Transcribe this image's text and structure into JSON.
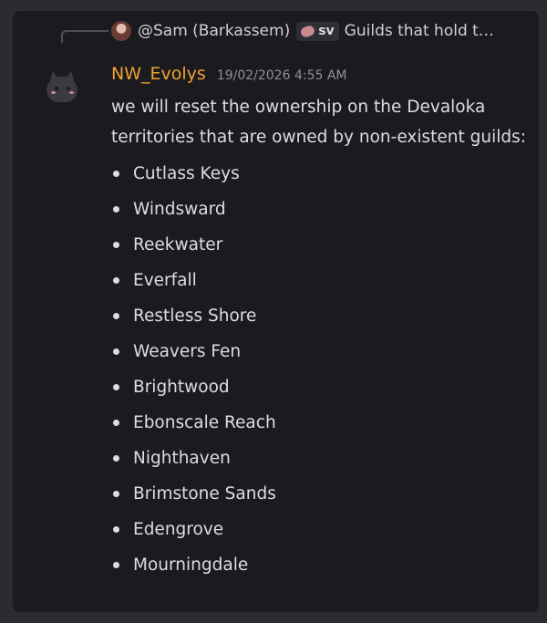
{
  "reply": {
    "author": "@Sam (Barkassem)",
    "tag_label": "sv",
    "preview": "Guilds that hold t…"
  },
  "message": {
    "username": "NW_Evolys",
    "timestamp": "19/02/2026 4:55 AM",
    "text": "we will reset the ownership on the Devaloka territories that are owned by non-existent guilds:",
    "territories": [
      "Cutlass Keys",
      "Windsward",
      "Reekwater",
      "Everfall",
      "Restless Shore",
      "Weavers Fen",
      "Brightwood",
      "Ebonscale Reach",
      "Nighthaven",
      "Brimstone Sands",
      "Edengrove",
      "Mourningdale"
    ]
  },
  "colors": {
    "username": "#f0a231",
    "background": "#1b1b1f",
    "text": "#dbdee1"
  },
  "icons": {
    "reply_avatar": "user-avatar-photo",
    "tag_icon": "brain-icon",
    "author_avatar": "cat-avatar"
  }
}
